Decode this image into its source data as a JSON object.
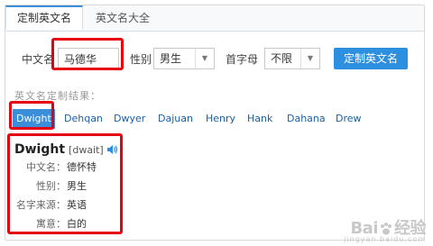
{
  "tabs": [
    {
      "label": "定制英文名",
      "active": true
    },
    {
      "label": "英文名大全",
      "active": false
    }
  ],
  "form": {
    "chinese_name_label": "中文名",
    "chinese_name_value": "马德华",
    "gender_label": "性别",
    "gender_value": "男生",
    "initial_label": "首字母",
    "initial_value": "不限",
    "submit_label": "定制英文名"
  },
  "results": {
    "title": "英文名定制结果：",
    "names": [
      "Dwight",
      "Dehqan",
      "Dwyer",
      "Dajuan",
      "Henry",
      "Hank",
      "Dahana",
      "Drew"
    ],
    "selected_index": 0
  },
  "detail": {
    "name": "Dwight",
    "phonetic": "[dwait]",
    "rows": [
      {
        "key": "中文名：",
        "value": "德怀特"
      },
      {
        "key": "性别：",
        "value": "男生"
      },
      {
        "key": "名字来源：",
        "value": "英语"
      },
      {
        "key": "寓意：",
        "value": "白的"
      }
    ]
  },
  "watermark": {
    "brand": "Bai",
    "brand2": "经验",
    "sub": "jingyan.baidu.com"
  },
  "colors": {
    "accent": "#2d8fe0",
    "highlight_box": "#e60012",
    "link": "#1a5fa8"
  }
}
